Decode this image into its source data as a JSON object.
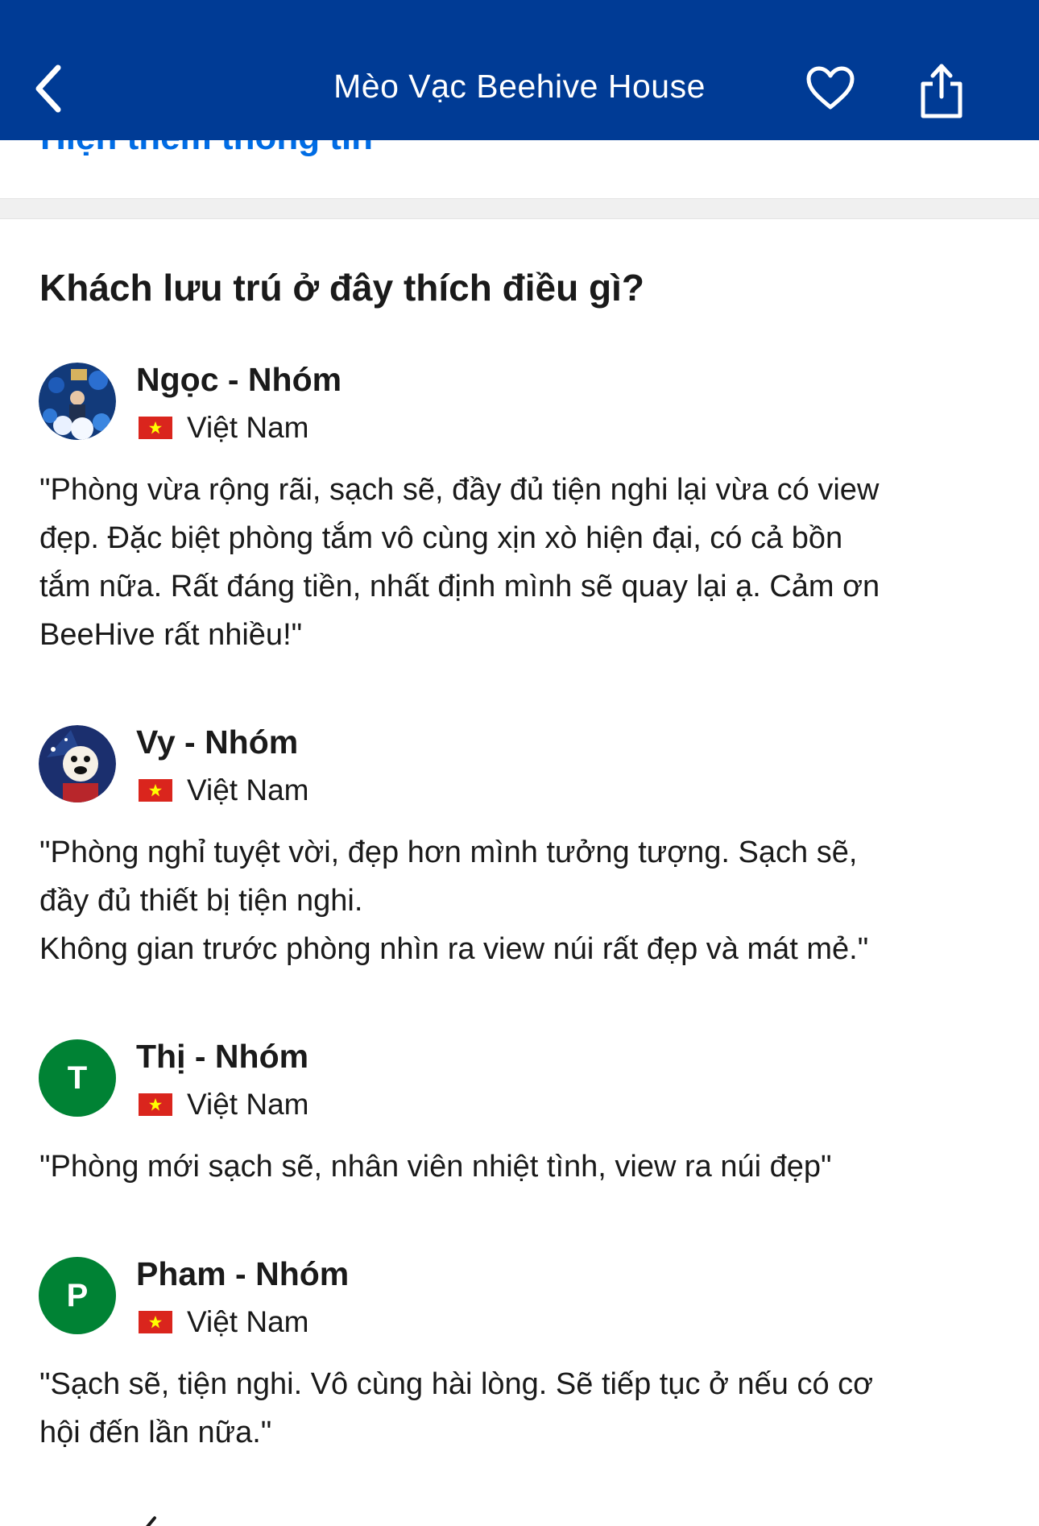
{
  "header": {
    "title": "Mèo Vạc Beehive House",
    "back_icon": "chevron-left-icon",
    "favorite_icon": "heart-outline-icon",
    "share_icon": "share-icon",
    "background": "#003b95"
  },
  "show_more": {
    "label": "Hiện thêm thông tin",
    "color": "#006ce4"
  },
  "section": {
    "title": "Khách lưu trú ở đây thích điều gì?"
  },
  "reviews": [
    {
      "name": "Ngọc - Nhóm",
      "country": "Việt Nam",
      "avatar_type": "photo",
      "text": "\"Phòng vừa rộng rãi, sạch sẽ, đầy đủ tiện nghi lại vừa có view\nđẹp. Đặc biệt phòng tắm vô cùng xịn xò hiện đại, có cả bồn\ntắm nữa. Rất đáng tiền, nhất định mình sẽ quay lại ạ. Cảm ơn\nBeeHive rất nhiều!\""
    },
    {
      "name": "Vy - Nhóm",
      "country": "Việt Nam",
      "avatar_type": "photo",
      "text": "\"Phòng nghỉ tuyệt vời, đẹp hơn mình tưởng tượng. Sạch sẽ,\nđầy đủ thiết bị tiện nghi.\nKhông gian trước phòng nhìn ra view núi rất đẹp và mát mẻ.\""
    },
    {
      "name": "Thị - Nhóm",
      "country": "Việt Nam",
      "avatar_type": "letter",
      "avatar_letter": "T",
      "text": "\"Phòng mới sạch sẽ, nhân viên nhiệt tình, view ra núi đẹp\""
    },
    {
      "name": "Pham - Nhóm",
      "country": "Việt Nam",
      "avatar_type": "letter",
      "avatar_letter": "P",
      "text": "\"Sạch sẽ, tiện nghi. Vô cùng hài lòng. Sẽ tiếp tục ở nếu có cơ\nhội đến lần nữa.\""
    }
  ],
  "colors": {
    "avatar_letter_bg": "#008234",
    "flag_red": "#da251d",
    "flag_star": "#ffff00"
  }
}
